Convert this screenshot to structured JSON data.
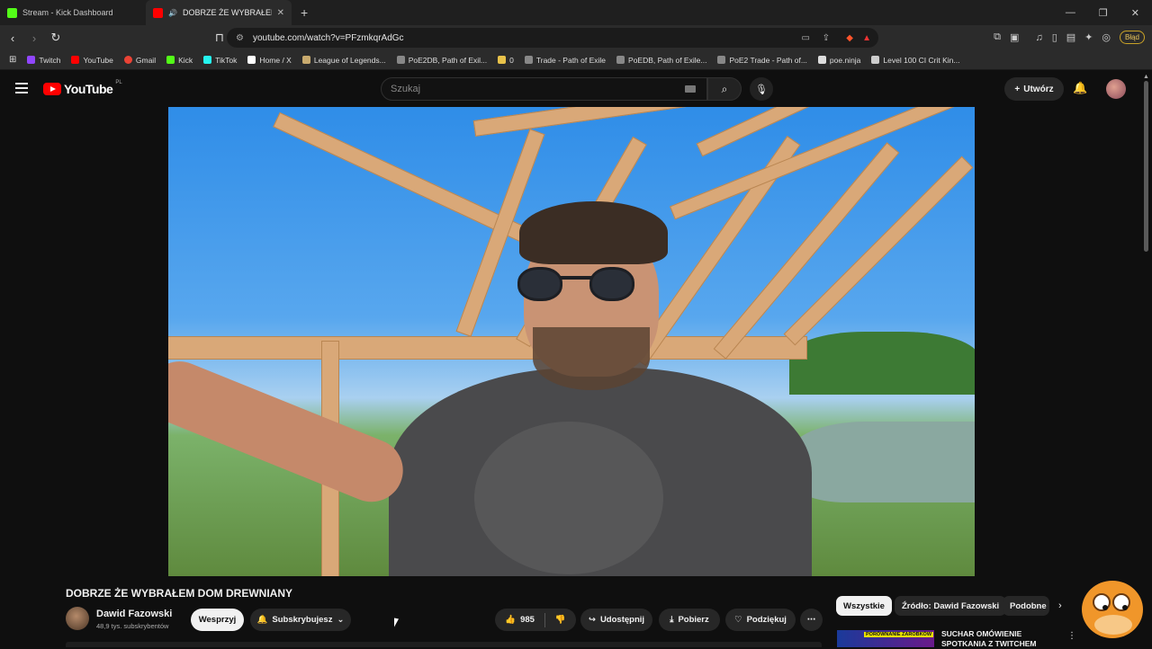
{
  "browser": {
    "tabs": [
      {
        "title": "Stream - Kick Dashboard",
        "favicon_color": "#53fc18"
      },
      {
        "title": "DOBRZE ŻE WYBRAŁEM DOM",
        "favicon_color": "#ff0000",
        "audio_icon": "speaker-icon"
      }
    ],
    "new_tab": "+",
    "url": "youtube.com/watch?v=PFzmkqrAdGc",
    "error_button": "Błąd",
    "bookmarks": [
      {
        "label": "Twitch",
        "color": "#9146ff"
      },
      {
        "label": "YouTube",
        "color": "#ff0000"
      },
      {
        "label": "Gmail",
        "color": "#ea4335"
      },
      {
        "label": "Kick",
        "color": "#53fc18"
      },
      {
        "label": "TikTok",
        "color": "#25f4ee"
      },
      {
        "label": "Home / X",
        "color": "#ffffff"
      },
      {
        "label": "League of Legends...",
        "color": "#c8aa6e"
      },
      {
        "label": "PoE2DB, Path of Exil...",
        "color": "#888888"
      },
      {
        "label": "0",
        "color": "#e8c24a"
      },
      {
        "label": "Trade - Path of Exile",
        "color": "#888888"
      },
      {
        "label": "PoEDB, Path of Exile...",
        "color": "#888888"
      },
      {
        "label": "PoE2 Trade - Path of...",
        "color": "#888888"
      },
      {
        "label": "poe.ninja",
        "color": "#dddddd"
      },
      {
        "label": "Level 100 CI Crit Kin...",
        "color": "#cccccc"
      }
    ]
  },
  "youtube": {
    "logo_text": "YouTube",
    "region": "PL",
    "search_placeholder": "Szukaj",
    "create_label": "Utwórz",
    "video": {
      "title": "DOBRZE ŻE WYBRAŁEM DOM DREWNIANY",
      "channel": "Dawid Fazowski",
      "subscribers": "48,9 tys. subskrybentów",
      "support_label": "Wesprzyj",
      "subscribed_label": "Subskrybujesz",
      "likes": "985",
      "share_label": "Udostępnij",
      "download_label": "Pobierz",
      "thanks_label": "Podziękuj"
    },
    "chips": [
      "Wszystkie",
      "Źródło: Dawid Fazowski",
      "Podobne"
    ],
    "recommendation": {
      "title": "SUCHAR OMÓWIENIE SPOTKANIA Z TWITCHEM",
      "thumb_tag": "PORÓWNANIE ZAROBKÓW"
    }
  }
}
